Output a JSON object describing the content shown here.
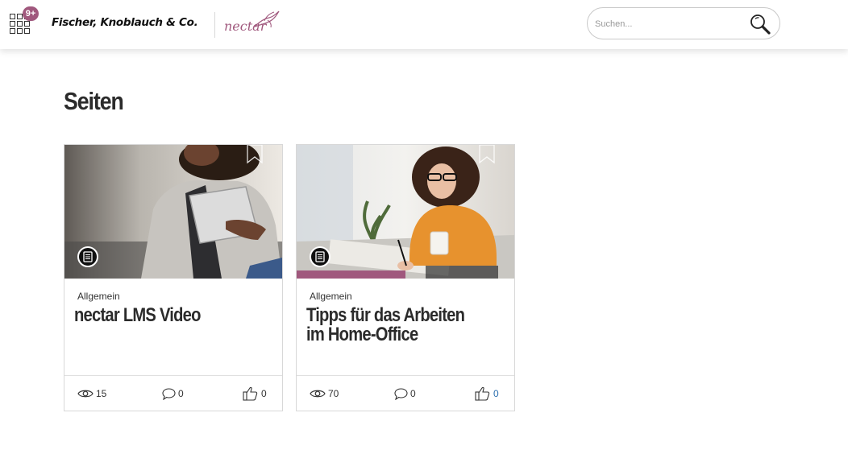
{
  "header": {
    "apps_badge": "9+",
    "brand_name": "Fischer, Knoblauch & Co.",
    "product_logo": "nectar",
    "search": {
      "placeholder": "Suchen..."
    }
  },
  "main": {
    "title": "Seiten",
    "cards": [
      {
        "category": "Allgemein",
        "title": "nectar LMS Video",
        "image": "woman-with-tablet-photo",
        "views": "15",
        "comments": "0",
        "likes": "0",
        "progress": 0
      },
      {
        "category": "Allgemein",
        "title": "Tipps für das Arbeiten im Home-Office",
        "image": "woman-working-at-desk-photo",
        "views": "70",
        "comments": "0",
        "likes": "0",
        "progress": 0.5
      }
    ]
  },
  "colors": {
    "accent": "#a0587d",
    "like_active": "#2a6fb0"
  },
  "icons": [
    "apps-grid-icon",
    "search-icon",
    "bookmark-icon",
    "document-icon",
    "eye-icon",
    "comment-icon",
    "thumbs-up-icon"
  ]
}
